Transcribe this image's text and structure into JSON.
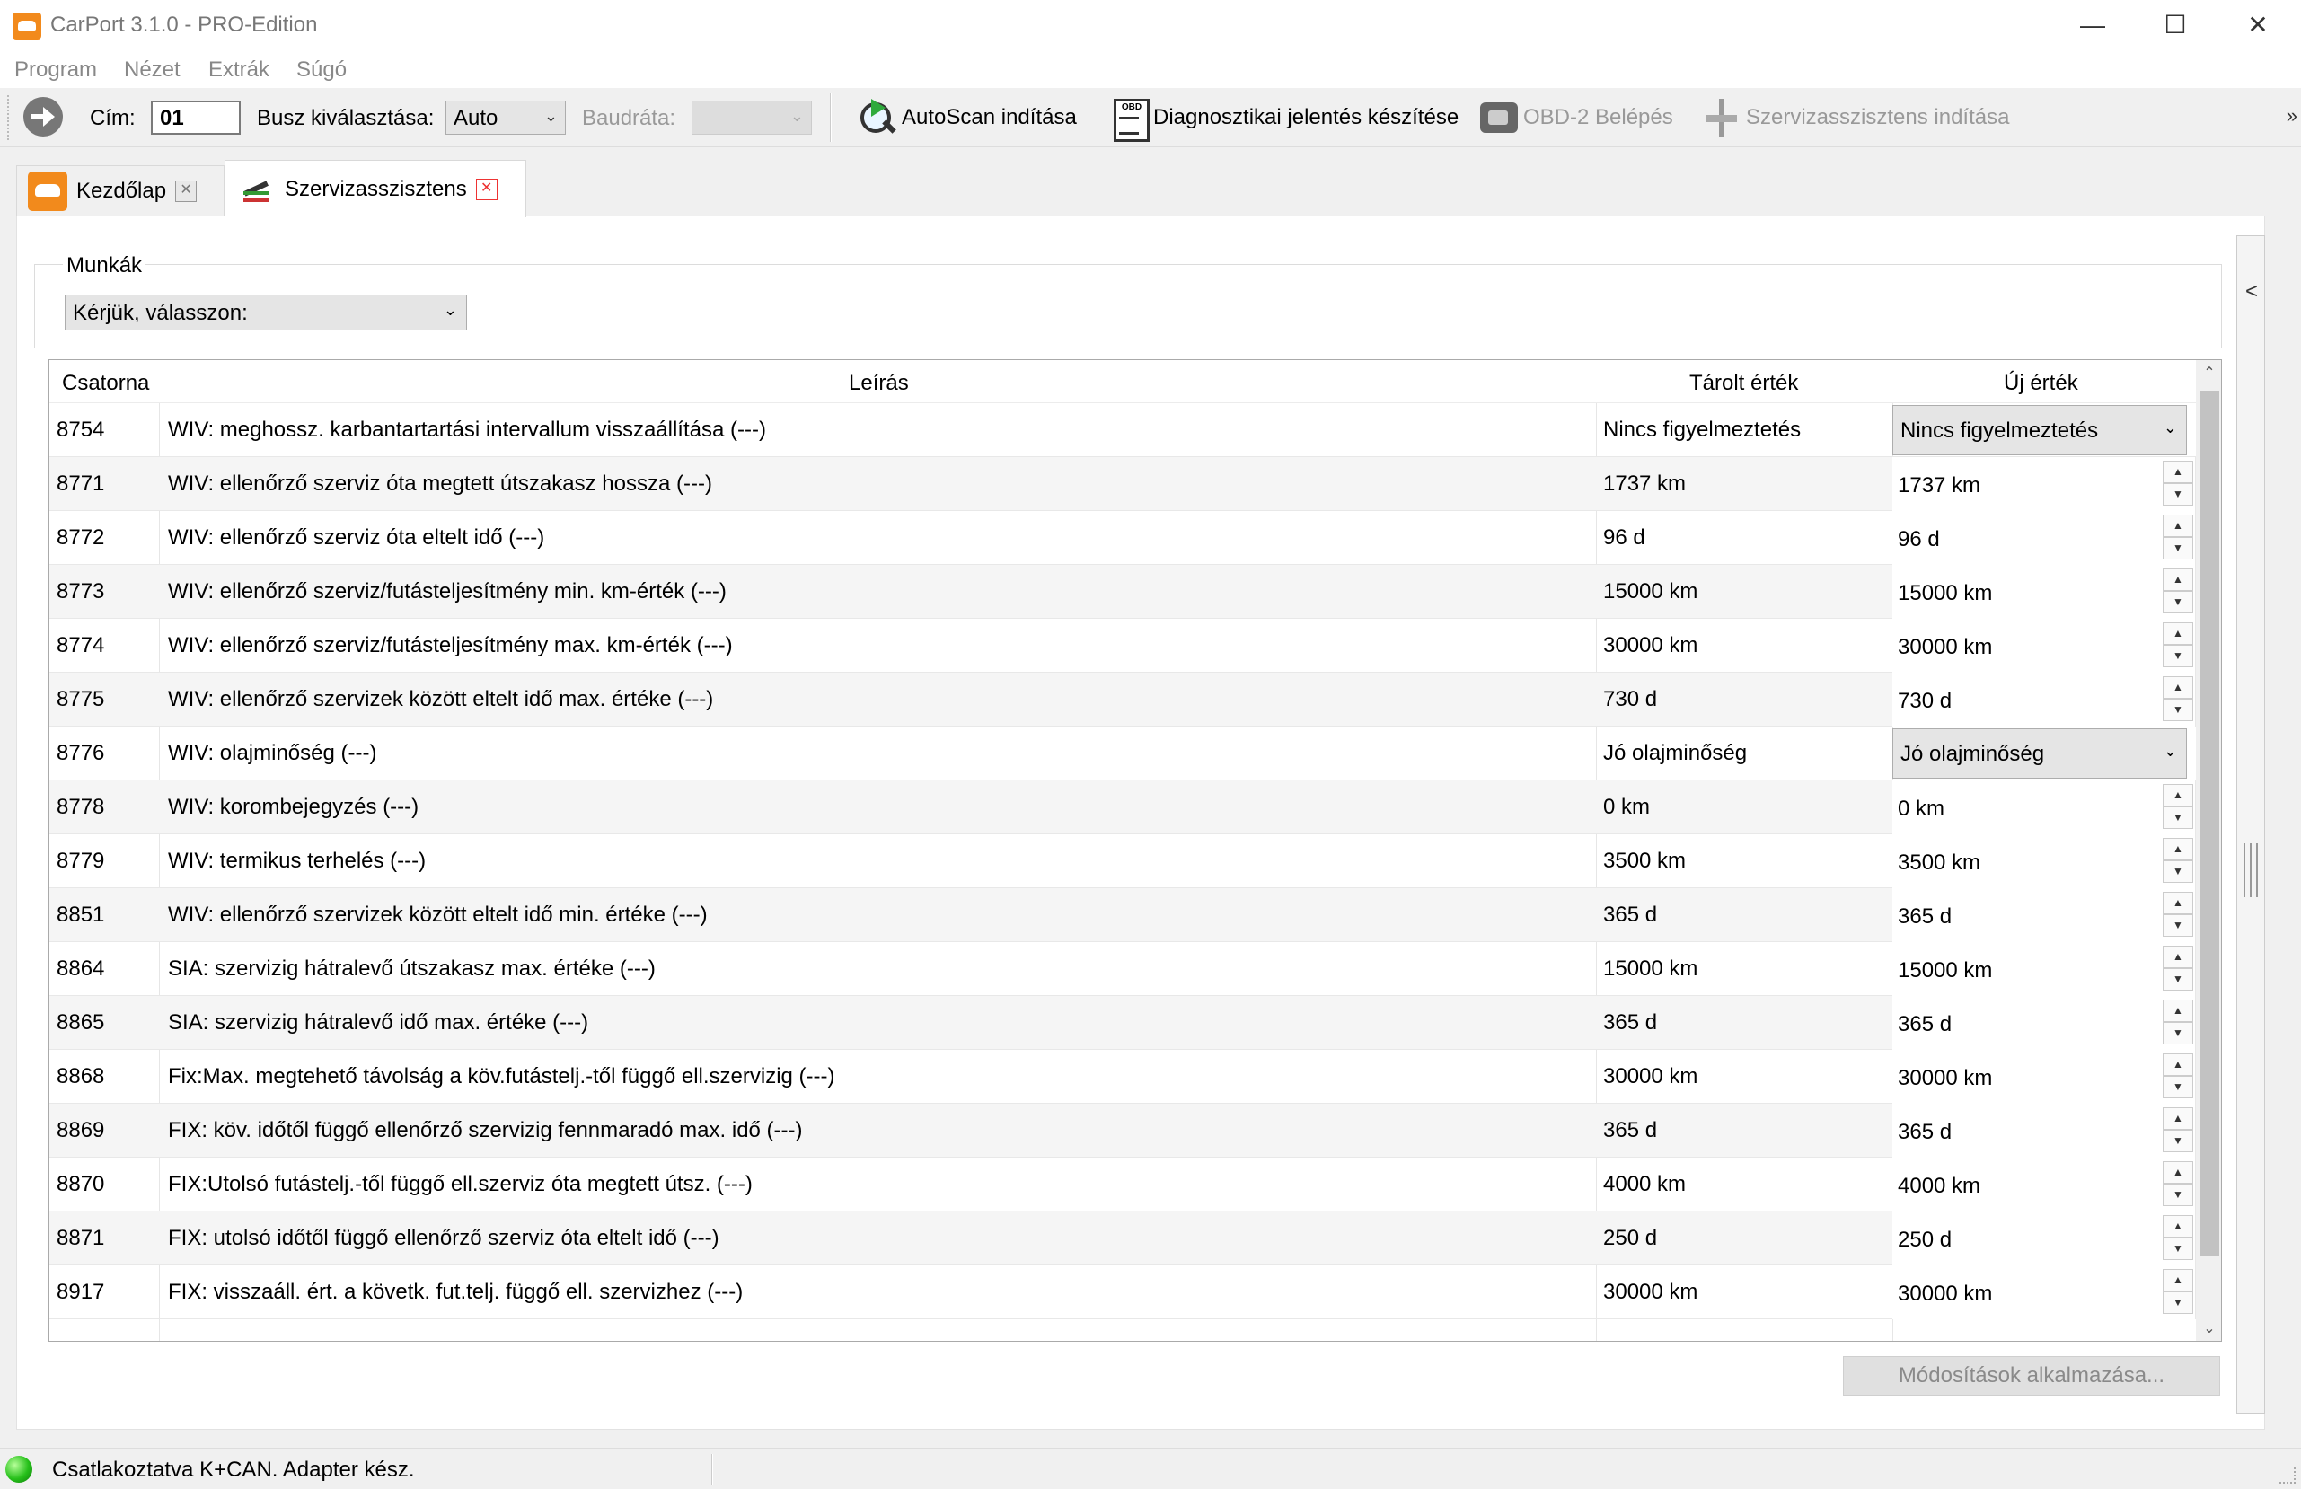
{
  "window": {
    "title": "CarPort 3.1.0 - PRO-Edition",
    "minimize_glyph": "—",
    "maximize_glyph": "☐",
    "close_glyph": "✕"
  },
  "menu": [
    "Program",
    "Nézet",
    "Extrák",
    "Súgó"
  ],
  "toolbar": {
    "address_label": "Cím:",
    "address_value": "01",
    "bus_label": "Busz kiválasztása:",
    "bus_value": "Auto",
    "baud_label": "Baudráta:",
    "baud_value": "",
    "autoscan": "AutoScan indítása",
    "report": "Diagnosztikai jelentés készítése",
    "obd_login": "OBD-2 Belépés",
    "service_assistant": "Szervizasszisztens indítása",
    "overflow_glyph": "»"
  },
  "tabs": [
    {
      "label": "Kezdőlap",
      "close_glyph": "✕"
    },
    {
      "label": "Szervizasszisztens",
      "close_glyph": "✕"
    }
  ],
  "jobs": {
    "group_label": "Munkák",
    "select_value": "Kérjük, válasszon:"
  },
  "side_toggle_glyph": "<",
  "table": {
    "headers": {
      "channel": "Csatorna",
      "description": "Leírás",
      "stored": "Tárolt érték",
      "new": "Új érték"
    },
    "rows": [
      {
        "channel": "8754",
        "description": "WIV: meghossz. karbantartartási intervallum visszaállítása (---)",
        "stored": "Nincs figyelmeztetés",
        "new": "Nincs figyelmeztetés",
        "editor": "combo"
      },
      {
        "channel": "8771",
        "description": "WIV: ellenőrző szerviz óta megtett útszakasz hossza (---)",
        "stored": "1737 km",
        "new": "1737 km",
        "editor": "spin"
      },
      {
        "channel": "8772",
        "description": "WIV: ellenőrző szerviz óta eltelt idő (---)",
        "stored": "96 d",
        "new": "96 d",
        "editor": "spin"
      },
      {
        "channel": "8773",
        "description": "WIV: ellenőrző szerviz/futásteljesítmény min. km-érték (---)",
        "stored": "15000 km",
        "new": "15000 km",
        "editor": "spin"
      },
      {
        "channel": "8774",
        "description": "WIV: ellenőrző szerviz/futásteljesítmény max. km-érték (---)",
        "stored": "30000 km",
        "new": "30000 km",
        "editor": "spin"
      },
      {
        "channel": "8775",
        "description": "WIV: ellenőrző szervizek között eltelt idő max. értéke (---)",
        "stored": "730 d",
        "new": "730 d",
        "editor": "spin"
      },
      {
        "channel": "8776",
        "description": "WIV: olajminőség (---)",
        "stored": "Jó olajminőség",
        "new": "Jó olajminőség",
        "editor": "combo"
      },
      {
        "channel": "8778",
        "description": "WIV: korombejegyzés (---)",
        "stored": "0 km",
        "new": "0 km",
        "editor": "spin"
      },
      {
        "channel": "8779",
        "description": "WIV: termikus terhelés (---)",
        "stored": "3500 km",
        "new": "3500 km",
        "editor": "spin"
      },
      {
        "channel": "8851",
        "description": "WIV: ellenőrző szervizek között eltelt idő min. értéke (---)",
        "stored": "365 d",
        "new": "365 d",
        "editor": "spin"
      },
      {
        "channel": "8864",
        "description": "SIA: szervizig hátralevő útszakasz max. értéke (---)",
        "stored": "15000 km",
        "new": "15000 km",
        "editor": "spin"
      },
      {
        "channel": "8865",
        "description": "SIA: szervizig hátralevő idő max. értéke (---)",
        "stored": "365 d",
        "new": "365 d",
        "editor": "spin"
      },
      {
        "channel": "8868",
        "description": "Fix:Max. megtehető távolság a köv.futástelj.-től függő ell.szervizig (---)",
        "stored": "30000 km",
        "new": "30000 km",
        "editor": "spin"
      },
      {
        "channel": "8869",
        "description": "FIX: köv. időtől függő ellenőrző szervizig fennmaradó max. idő (---)",
        "stored": "365 d",
        "new": "365 d",
        "editor": "spin"
      },
      {
        "channel": "8870",
        "description": "FIX:Utolsó futástelj.-től függő ell.szerviz óta megtett útsz. (---)",
        "stored": "4000 km",
        "new": "4000 km",
        "editor": "spin"
      },
      {
        "channel": "8871",
        "description": "FIX: utolsó időtől függő ellenőrző szerviz óta eltelt idő (---)",
        "stored": "250 d",
        "new": "250 d",
        "editor": "spin"
      },
      {
        "channel": "8917",
        "description": "FIX: visszaáll. ért. a követk. fut.telj. függő ell. szervizhez (---)",
        "stored": "30000 km",
        "new": "30000 km",
        "editor": "spin"
      }
    ],
    "spin_up": "▲",
    "spin_down": "▼",
    "combo_chevron": "⌄",
    "scroll_up": "⌃",
    "scroll_down": "⌄"
  },
  "apply_button": "Módosítások alkalmazása...",
  "status": {
    "text": "Csatlakoztatva K+CAN. Adapter kész."
  }
}
